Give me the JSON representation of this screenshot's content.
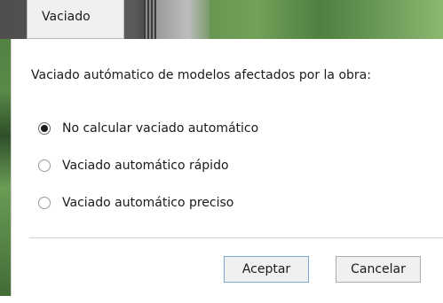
{
  "tab": {
    "label": "Vaciado"
  },
  "dialog": {
    "prompt": "Vaciado autómatico de modelos afectados por la obra:",
    "options": [
      {
        "label": "No calcular vaciado automático",
        "checked": true
      },
      {
        "label": "Vaciado automático rápido",
        "checked": false
      },
      {
        "label": "Vaciado automático preciso",
        "checked": false
      }
    ],
    "buttons": {
      "accept": "Aceptar",
      "cancel": "Cancelar"
    }
  }
}
